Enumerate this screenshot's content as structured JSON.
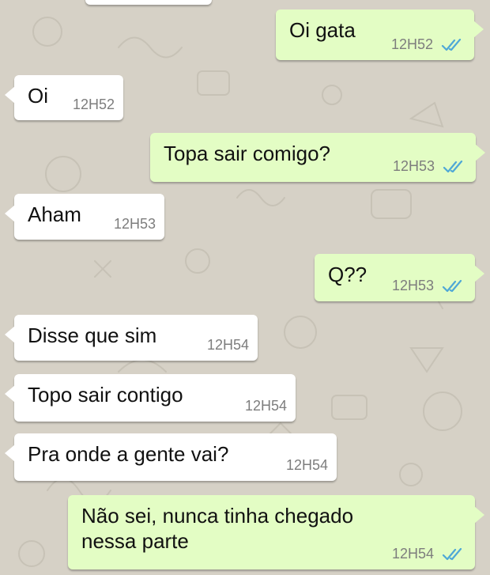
{
  "colors": {
    "wallpaper": "#d6d1c6",
    "incoming_bubble": "#ffffff",
    "outgoing_bubble": "#e3fdc4",
    "read_ticks": "#4fa8d6",
    "timestamp": "#7d7d7d"
  },
  "messages": [
    {
      "direction": "outgoing",
      "text": "Oi gata",
      "time": "12H52",
      "status": "read",
      "status_icon": "double-check-icon"
    },
    {
      "direction": "incoming",
      "text": "Oi",
      "time": "12H52"
    },
    {
      "direction": "outgoing",
      "text": "Topa sair comigo?",
      "time": "12H53",
      "status": "read",
      "status_icon": "double-check-icon"
    },
    {
      "direction": "incoming",
      "text": "Aham",
      "time": "12H53"
    },
    {
      "direction": "outgoing",
      "text": "Q??",
      "time": "12H53",
      "status": "read",
      "status_icon": "double-check-icon"
    },
    {
      "direction": "incoming",
      "text": "Disse que sim",
      "time": "12H54"
    },
    {
      "direction": "incoming",
      "text": "Topo sair contigo",
      "time": "12H54"
    },
    {
      "direction": "incoming",
      "text": "Pra onde a gente vai?",
      "time": "12H54"
    },
    {
      "direction": "outgoing",
      "text": "Não sei, nunca tinha chegado\nnessa parte",
      "time": "12H54",
      "status": "read",
      "status_icon": "double-check-icon"
    }
  ]
}
